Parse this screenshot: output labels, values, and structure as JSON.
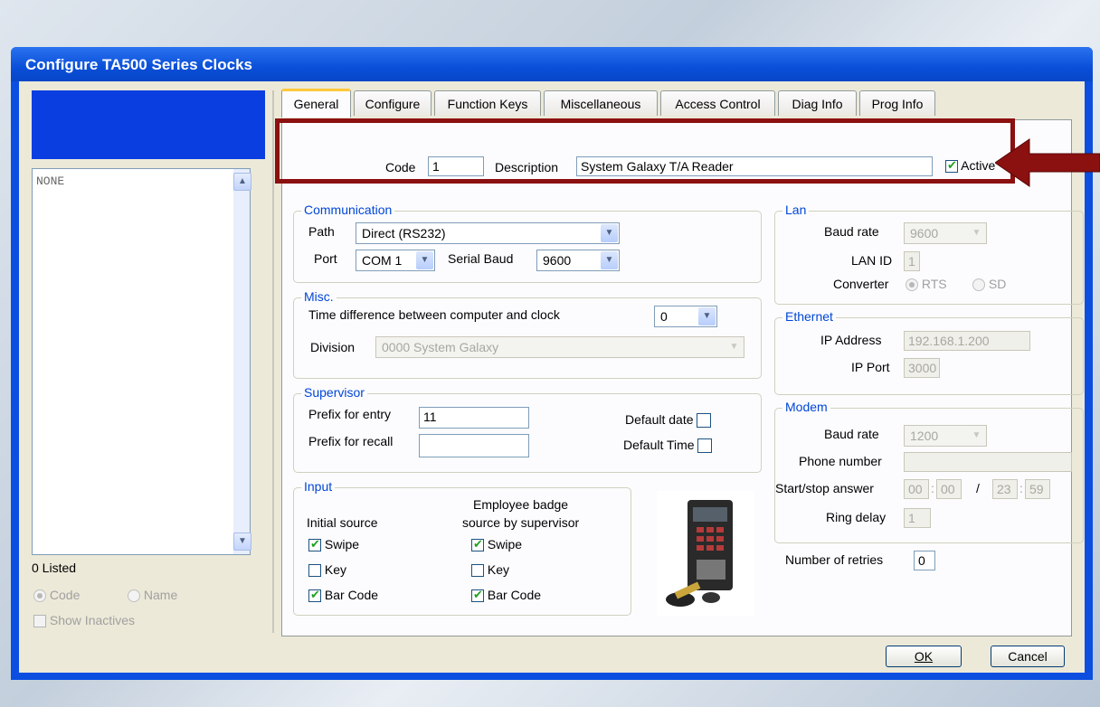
{
  "window": {
    "title": "Configure TA500 Series Clocks"
  },
  "left": {
    "list_items": [
      "NONE"
    ],
    "listed_count": "0 Listed",
    "sort_code": "Code",
    "sort_name": "Name",
    "show_inactives": "Show Inactives"
  },
  "tabs": [
    "General",
    "Configure",
    "Function Keys",
    "Miscellaneous",
    "Access Control",
    "Diag Info",
    "Prog Info"
  ],
  "header": {
    "code_label": "Code",
    "code_value": "1",
    "description_label": "Description",
    "description_value": "System Galaxy T/A Reader",
    "active_label": "Active",
    "active_checked": true
  },
  "communication": {
    "label": "Communication",
    "path_label": "Path",
    "path_value": "Direct (RS232)",
    "port_label": "Port",
    "port_value": "COM 1",
    "serial_baud_label": "Serial Baud",
    "serial_baud_value": "9600"
  },
  "misc": {
    "label": "Misc.",
    "time_diff_label": "Time difference between computer and clock",
    "time_diff_value": "0",
    "division_label": "Division",
    "division_value": "0000  System Galaxy"
  },
  "supervisor": {
    "label": "Supervisor",
    "prefix_entry_label": "Prefix for entry",
    "prefix_entry_value": "11",
    "prefix_recall_label": "Prefix for recall",
    "prefix_recall_value": "",
    "default_date_label": "Default date",
    "default_time_label": "Default Time"
  },
  "input": {
    "label": "Input",
    "initial_source_label": "Initial source",
    "badge_source_label_1": "Employee badge",
    "badge_source_label_2": "source by supervisor",
    "swipe": "Swipe",
    "key": "Key",
    "bar_code": "Bar Code"
  },
  "lan": {
    "label": "Lan",
    "baud_rate_label": "Baud rate",
    "baud_rate_value": "9600",
    "lan_id_label": "LAN ID",
    "lan_id_value": "1",
    "converter_label": "Converter",
    "rts": "RTS",
    "sd": "SD"
  },
  "ethernet": {
    "label": "Ethernet",
    "ip_address_label": "IP Address",
    "ip_address_value": "192.168.1.200",
    "ip_port_label": "IP Port",
    "ip_port_value": "3000"
  },
  "modem": {
    "label": "Modem",
    "baud_rate_label": "Baud rate",
    "baud_rate_value": "1200",
    "phone_label": "Phone number",
    "phone_value": "",
    "start_stop_label": "Start/stop answer",
    "start_h": "00",
    "start_m": "00",
    "sep": "/",
    "end_h": "23",
    "end_m": "59",
    "ring_delay_label": "Ring delay",
    "ring_delay_value": "1"
  },
  "retries": {
    "label": "Number of retries",
    "value": "0"
  },
  "buttons": {
    "ok": "OK",
    "cancel": "Cancel"
  },
  "colors": {
    "highlight_box": "#8b1010",
    "arrow": "#8b1010",
    "title_bar": "#0b4ee0",
    "group_label": "#0046d5"
  }
}
